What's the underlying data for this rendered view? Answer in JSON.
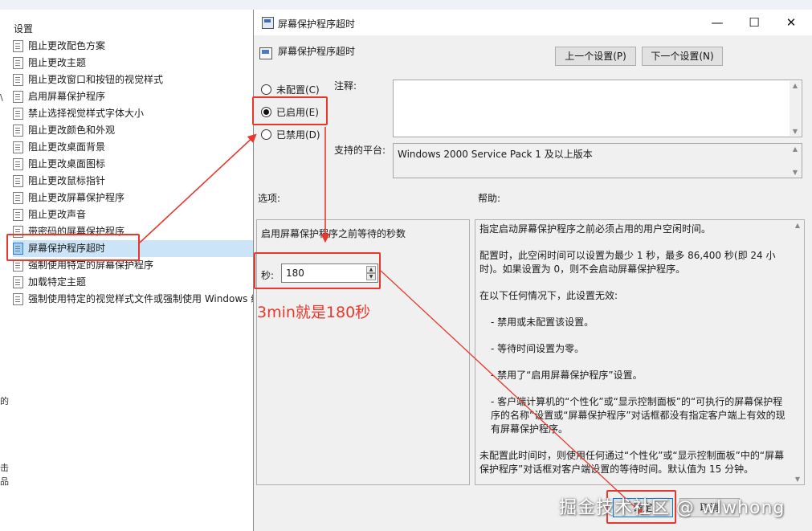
{
  "policy_list": {
    "header": "设置",
    "items": [
      "阻止更改配色方案",
      "阻止更改主题",
      "阻止更改窗口和按钮的视觉样式",
      "启用屏幕保护程序",
      "禁止选择视觉样式字体大小",
      "阻止更改颜色和外观",
      "阻止更改桌面背景",
      "阻止更改桌面图标",
      "阻止更改鼠标指针",
      "阻止更改屏幕保护程序",
      "阻止更改声音",
      "带密码的屏幕保护程序",
      "屏幕保护程序超时",
      "强制使用特定的屏幕保护程序",
      "加载特定主题",
      "强制使用特定的视觉样式文件或强制使用 Windows 经"
    ],
    "edge_glyphs": [
      "\\",
      "的",
      "击",
      "品"
    ]
  },
  "dialog": {
    "window_title": "屏幕保护程序超时",
    "policy_title": "屏幕保护程序超时",
    "prev_button": "上一个设置(P)",
    "next_button": "下一个设置(N)",
    "radios": {
      "not_configured": "未配置(C)",
      "enabled": "已启用(E)",
      "disabled": "已禁用(D)"
    },
    "comment_label": "注释:",
    "platform_label": "支持的平台:",
    "platform_value": "Windows 2000 Service Pack 1 及以上版本",
    "options_label": "选项:",
    "help_label": "帮助:",
    "options_desc": "启用屏幕保护程序之前等待的秒数",
    "seconds_label": "秒:",
    "seconds_value": "180",
    "help_paragraphs": [
      "指定启动屏幕保护程序之前必须占用的用户空闲时间。",
      "配置时，此空闲时间可以设置为最少 1 秒，最多 86,400 秒(即 24 小时)。如果设置为 0，则不会启动屏幕保护程序。",
      "在以下任何情况下，此设置无效:",
      "- 禁用或未配置该设置。",
      "- 等待时间设置为零。",
      "- 禁用了“启用屏幕保护程序”设置。",
      "- 客户端计算机的“个性化”或“显示控制面板”的“可执行的屏幕保护程序的名称”设置或“屏幕保护程序”对话框都没有指定客户端上有效的现有屏幕保护程序。",
      "未配置此时间时，则使用任何通过“个性化”或“显示控制面板”中的“屏幕保护程序”对话框对客户端设置的等待时间。默认值为 15 分钟。"
    ],
    "ok_button": "确定",
    "cancel_button": "取消"
  },
  "annotation": {
    "text": "3min就是180秒",
    "watermark": "掘金技术社区 @ wlwhong",
    "color": "#e8382e"
  }
}
